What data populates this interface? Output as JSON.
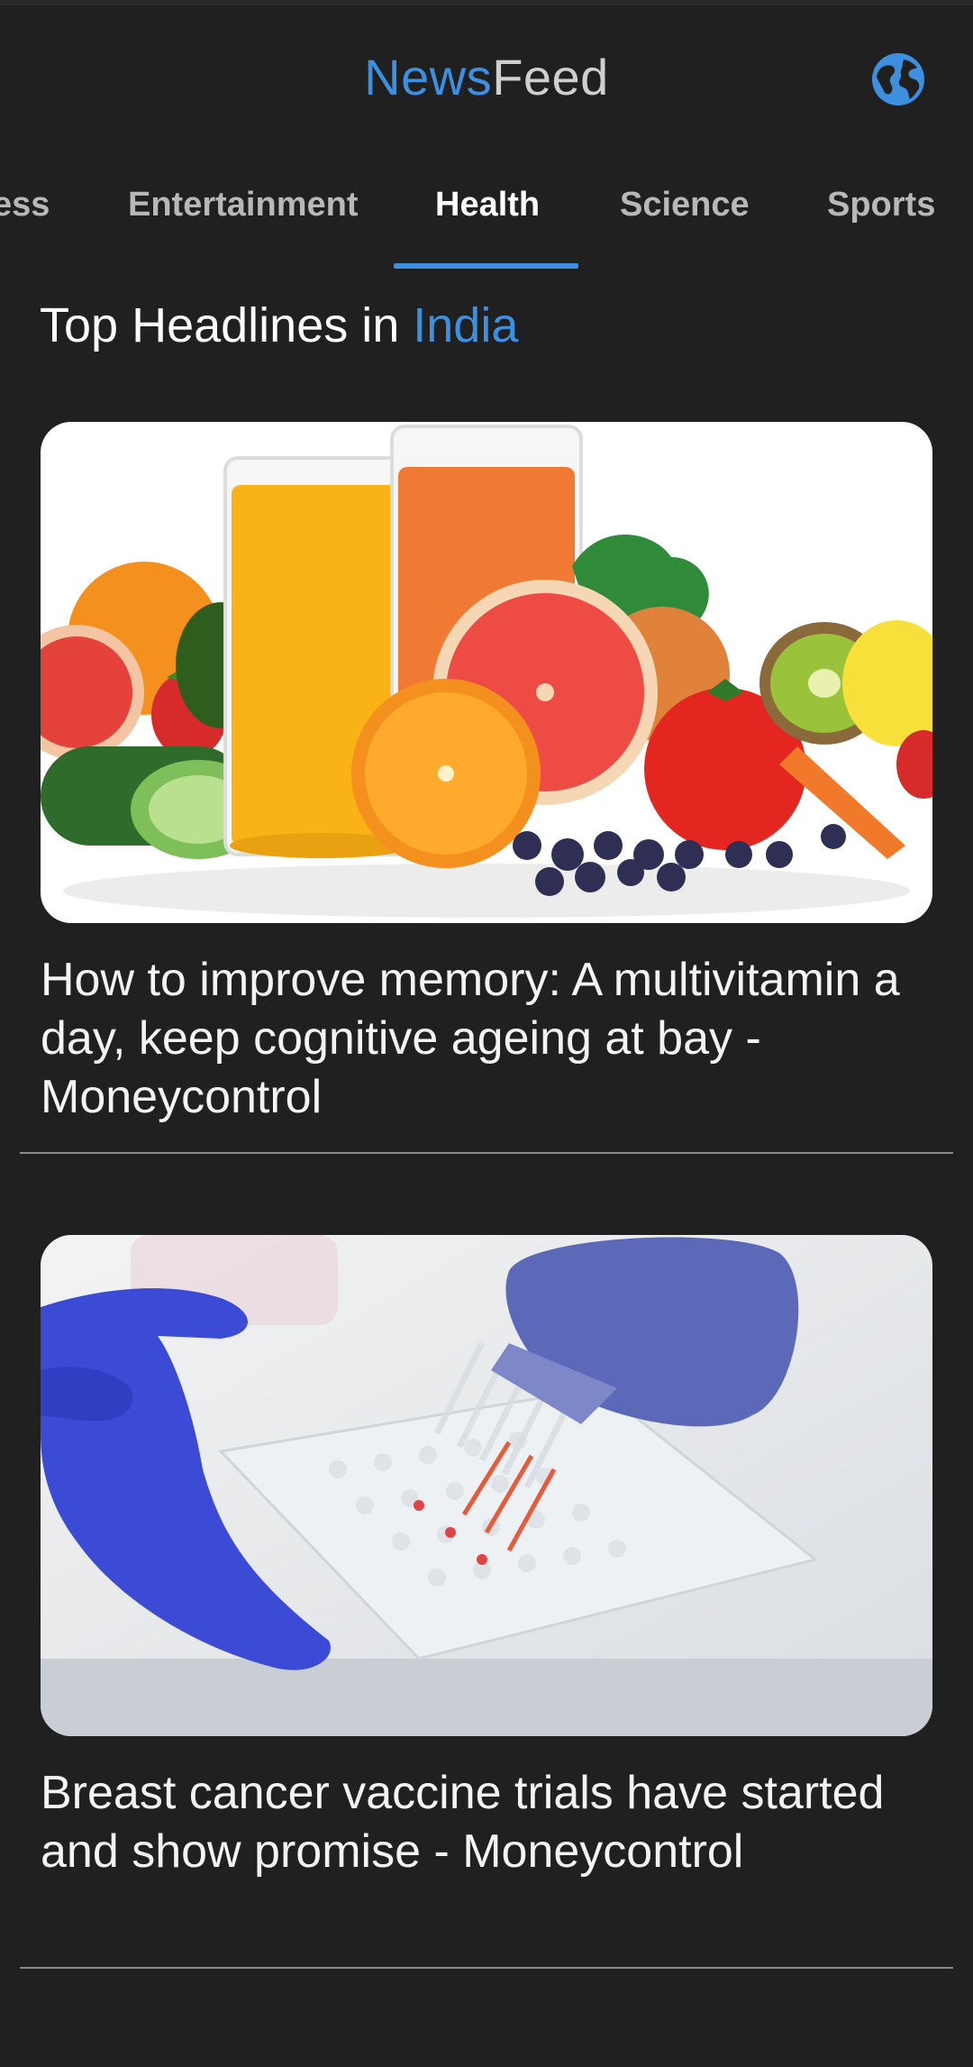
{
  "app": {
    "title_part1": "News",
    "title_part2": "Feed",
    "globe_icon": "globe-icon",
    "accent_color": "#3d8fe0"
  },
  "tabs": [
    {
      "label": "ess"
    },
    {
      "label": "Entertainment"
    },
    {
      "label": "Health",
      "active": true
    },
    {
      "label": "Science"
    },
    {
      "label": "Sports"
    }
  ],
  "section": {
    "prefix": "Top Headlines in ",
    "country": "India"
  },
  "articles": [
    {
      "image": "fruits-and-juice-image",
      "title": "How to improve memory: A multivitamin a day, keep cognitive ageing at bay - Moneycontrol"
    },
    {
      "image": "lab-pipette-image",
      "title": "Breast cancer vaccine trials have started and show promise - Moneycontrol"
    }
  ]
}
